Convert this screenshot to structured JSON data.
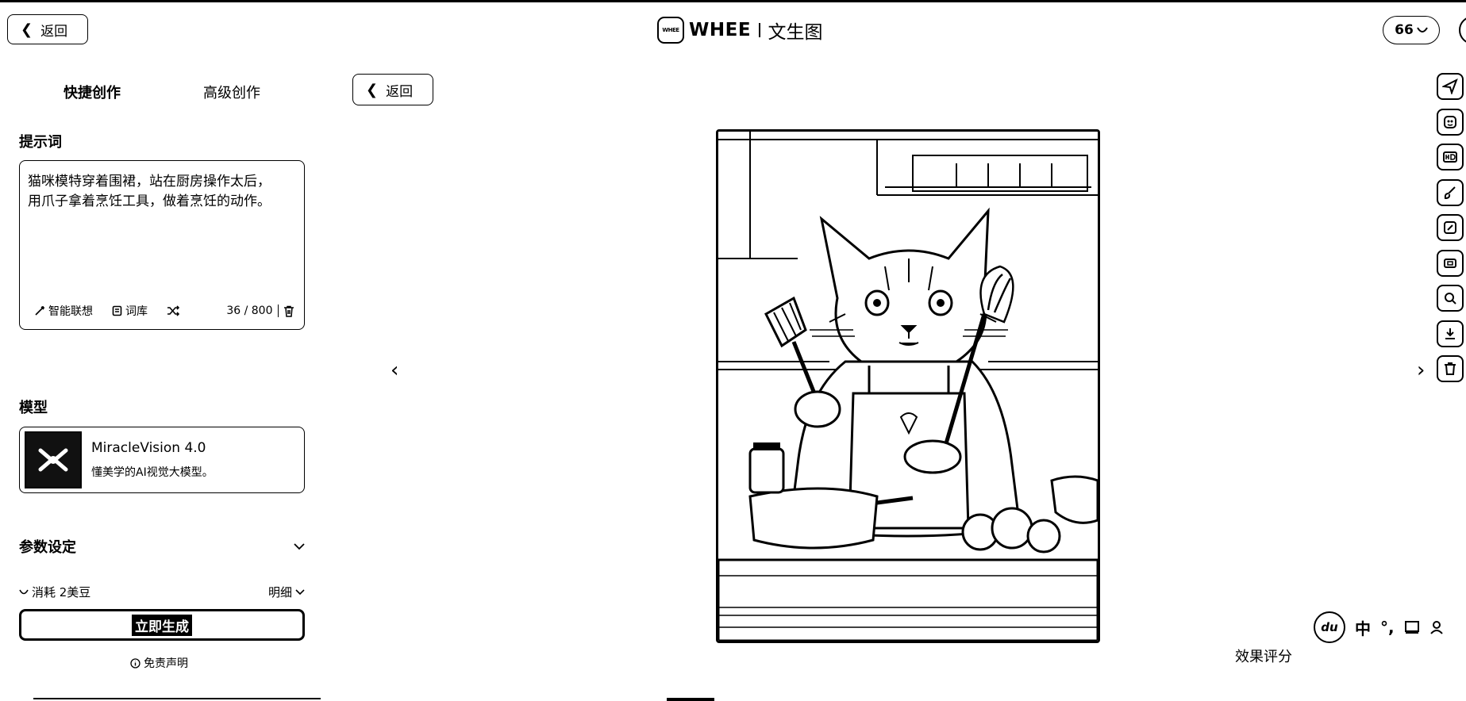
{
  "header": {
    "back_label": "返回",
    "brand_logo_text": "WHEE",
    "brand_name": "WHEE",
    "page_title": "文生图",
    "credits": "66"
  },
  "left_panel": {
    "tabs": [
      {
        "label": "快捷创作",
        "active": true
      },
      {
        "label": "高级创作",
        "active": false
      }
    ],
    "prompt": {
      "label": "提示词",
      "value": "猫咪模特穿着围裙，站在厨房操作太后，用爪子拿着烹饪工具，做着烹饪的动作。",
      "tools": [
        "智能联想",
        "词库"
      ],
      "counter": "36 / 800"
    },
    "model": {
      "label": "模型",
      "name": "MiracleVision 4.0",
      "description": "懂美学的AI视觉大模型。"
    },
    "params": {
      "label": "参数设定"
    },
    "cost": {
      "text": "消耗 2美豆",
      "detail_label": "明细"
    },
    "generate_label": "立即生成",
    "disclaimer": "免责声明"
  },
  "center": {
    "back_label": "返回",
    "rating_label": "效果评分",
    "image_subject": "cat chef in apron holding spatula and whisk in kitchen"
  },
  "right_toolbar": {
    "icons": [
      "send-icon",
      "face-icon",
      "hd-icon",
      "brush-icon",
      "edit-icon",
      "expand-icon",
      "search-icon",
      "download-icon",
      "delete-icon"
    ]
  },
  "ime": {
    "logo": "du",
    "lang": "中",
    "punct": "°,"
  }
}
